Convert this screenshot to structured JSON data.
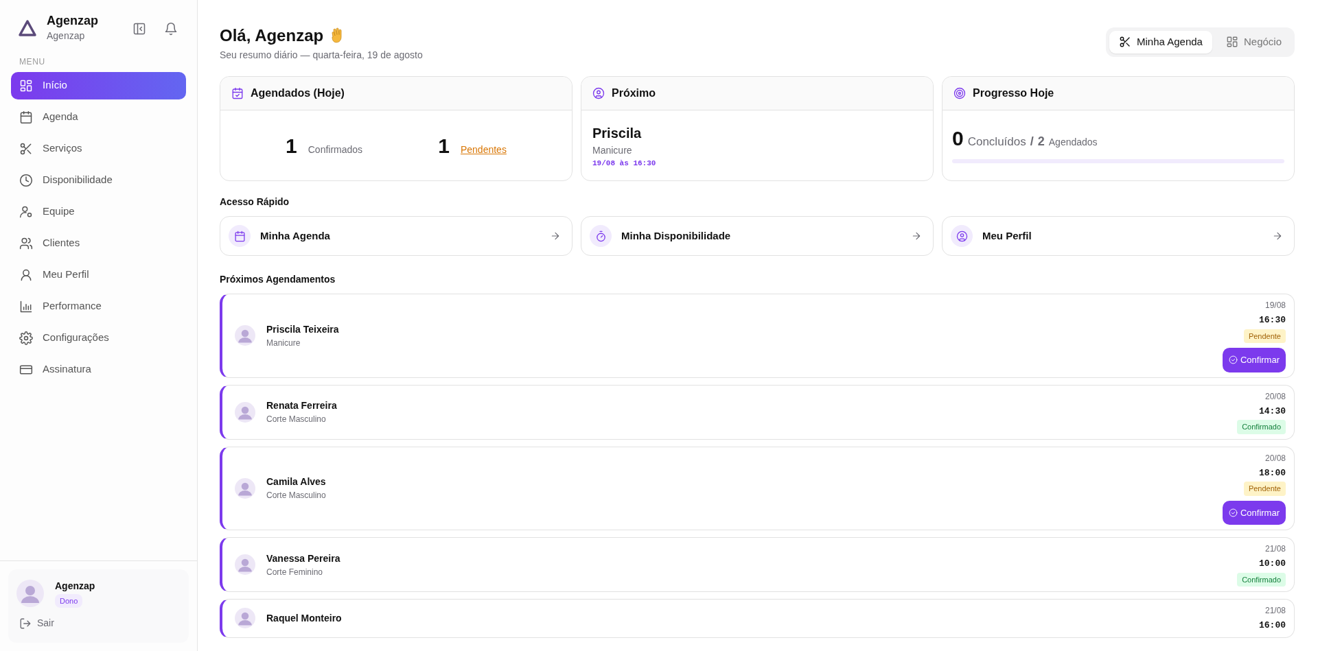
{
  "brand": {
    "name": "Agenzap",
    "subtitle": "Agenzap"
  },
  "sidebar": {
    "section_label": "MENU",
    "items": [
      {
        "label": "Início",
        "selected": true
      },
      {
        "label": "Agenda",
        "selected": false
      },
      {
        "label": "Serviços",
        "selected": false
      },
      {
        "label": "Disponibilidade",
        "selected": false
      },
      {
        "label": "Equipe",
        "selected": false
      },
      {
        "label": "Clientes",
        "selected": false
      },
      {
        "label": "Meu Perfil",
        "selected": false
      },
      {
        "label": "Performance",
        "selected": false
      },
      {
        "label": "Configurações",
        "selected": false
      },
      {
        "label": "Assinatura",
        "selected": false
      }
    ]
  },
  "user": {
    "name": "Agenzap",
    "role": "Dono",
    "logout": "Sair"
  },
  "header": {
    "greeting": "Olá, Agenzap",
    "subtitle": "Seu resumo diário — quarta-feira, 19 de agosto"
  },
  "view_tabs": [
    {
      "label": "Minha Agenda",
      "selected": true
    },
    {
      "label": "Negócio",
      "selected": false
    }
  ],
  "summary_cards": {
    "scheduled": {
      "title": "Agendados (Hoje)",
      "confirmed_count": "1",
      "confirmed_label": "Confirmados",
      "pending_count": "1",
      "pending_label": "Pendentes"
    },
    "next": {
      "title": "Próximo",
      "client": "Priscila",
      "service": "Manicure",
      "when": "19/08 às 16:30"
    },
    "progress": {
      "title": "Progresso Hoje",
      "done": "0",
      "done_label": "Concluídos",
      "separator": "/",
      "total": "2",
      "total_label": "Agendados",
      "level": 0
    }
  },
  "quick_access": {
    "title": "Acesso Rápido",
    "links": [
      {
        "label": "Minha Agenda"
      },
      {
        "label": "Minha Disponibilidade"
      },
      {
        "label": "Meu Perfil"
      }
    ]
  },
  "appointments": {
    "title": "Próximos Agendamentos",
    "items": [
      {
        "client": "Priscila Teixeira",
        "service": "Manicure",
        "date": "19/08",
        "time": "16:30",
        "status": {
          "kind": "pending",
          "label": "Pendente"
        },
        "action": "Confirmar"
      },
      {
        "client": "Renata Ferreira",
        "service": "Corte Masculino",
        "date": "20/08",
        "time": "14:30",
        "status": {
          "kind": "confirmed",
          "label": "Confirmado"
        }
      },
      {
        "client": "Camila Alves",
        "service": "Corte Masculino",
        "date": "20/08",
        "time": "18:00",
        "status": {
          "kind": "pending",
          "label": "Pendente"
        },
        "action": "Confirmar"
      },
      {
        "client": "Vanessa Pereira",
        "service": "Corte Feminino",
        "date": "21/08",
        "time": "10:00",
        "status": {
          "kind": "confirmed",
          "label": "Confirmado"
        }
      },
      {
        "client": "Raquel Monteiro",
        "date": "21/08",
        "time": "16:00"
      }
    ]
  }
}
